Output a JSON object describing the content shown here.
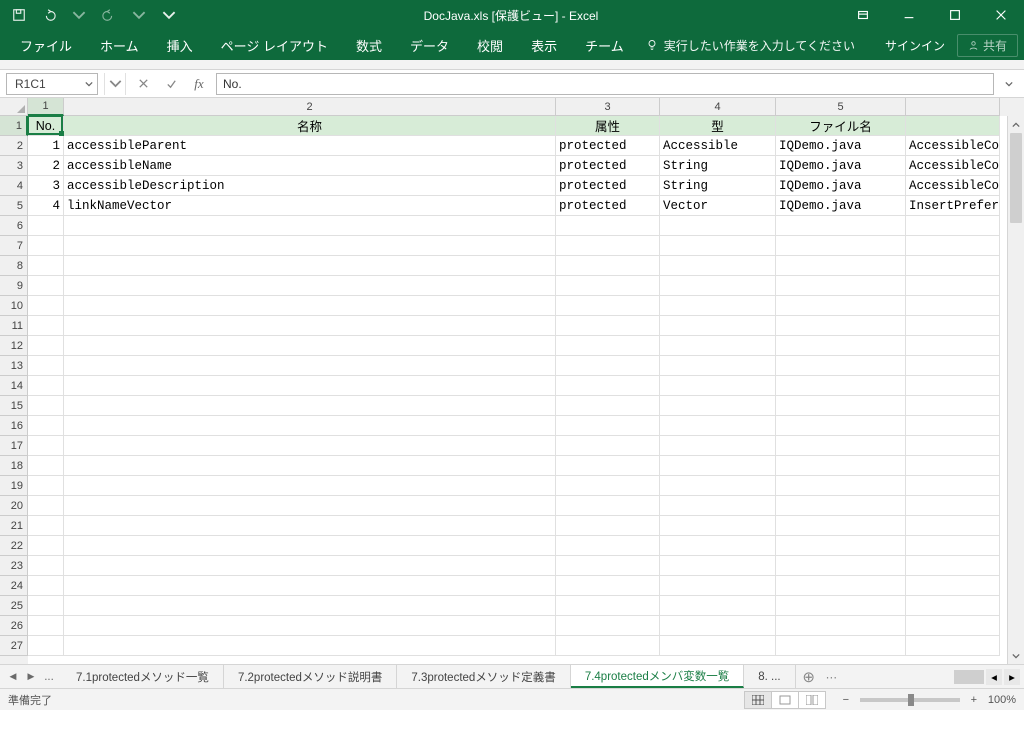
{
  "title": "DocJava.xls  [保護ビュー] - Excel",
  "qat": {
    "undo_icon": "undo",
    "redo_icon": "redo",
    "save_icon": "save",
    "customize_icon": "caret"
  },
  "win": {
    "ribbon_opts_icon": "ribbon-opts",
    "min_icon": "minimize",
    "max_icon": "maximize",
    "close_icon": "close"
  },
  "ribbon": {
    "tabs": [
      "ファイル",
      "ホーム",
      "挿入",
      "ページ レイアウト",
      "数式",
      "データ",
      "校閲",
      "表示",
      "チーム"
    ],
    "tell_me": "実行したい作業を入力してください",
    "signin": "サインイン",
    "share": "共有"
  },
  "namebox": "R1C1",
  "formula": "No.",
  "columns": {
    "headers": [
      "1",
      "2",
      "3",
      "4",
      "5"
    ]
  },
  "table": {
    "headers": [
      "No.",
      "名称",
      "属性",
      "型",
      "ファイル名",
      ""
    ],
    "rows": [
      {
        "no": "1",
        "name": "accessibleParent",
        "attr": "protected",
        "type": "Accessible",
        "file": "IQDemo.java",
        "extra": "AccessibleCo"
      },
      {
        "no": "2",
        "name": "accessibleName",
        "attr": "protected",
        "type": "String",
        "file": "IQDemo.java",
        "extra": "AccessibleCo"
      },
      {
        "no": "3",
        "name": "accessibleDescription",
        "attr": "protected",
        "type": "String",
        "file": "IQDemo.java",
        "extra": "AccessibleCo"
      },
      {
        "no": "4",
        "name": "linkNameVector",
        "attr": "protected",
        "type": "Vector",
        "file": "IQDemo.java",
        "extra": "InsertPrefer"
      }
    ]
  },
  "row_count": 27,
  "sheets": {
    "tabs": [
      {
        "label": "7.1protectedメソッド一覧",
        "active": false
      },
      {
        "label": "7.2protectedメソッド説明書",
        "active": false
      },
      {
        "label": "7.3protectedメソッド定義書",
        "active": false
      },
      {
        "label": "7.4protectedメンバ変数一覧",
        "active": true
      },
      {
        "label": "8. ...",
        "active": false
      }
    ],
    "ellipsis": "..."
  },
  "status": {
    "msg": "準備完了",
    "zoom": "100%"
  }
}
